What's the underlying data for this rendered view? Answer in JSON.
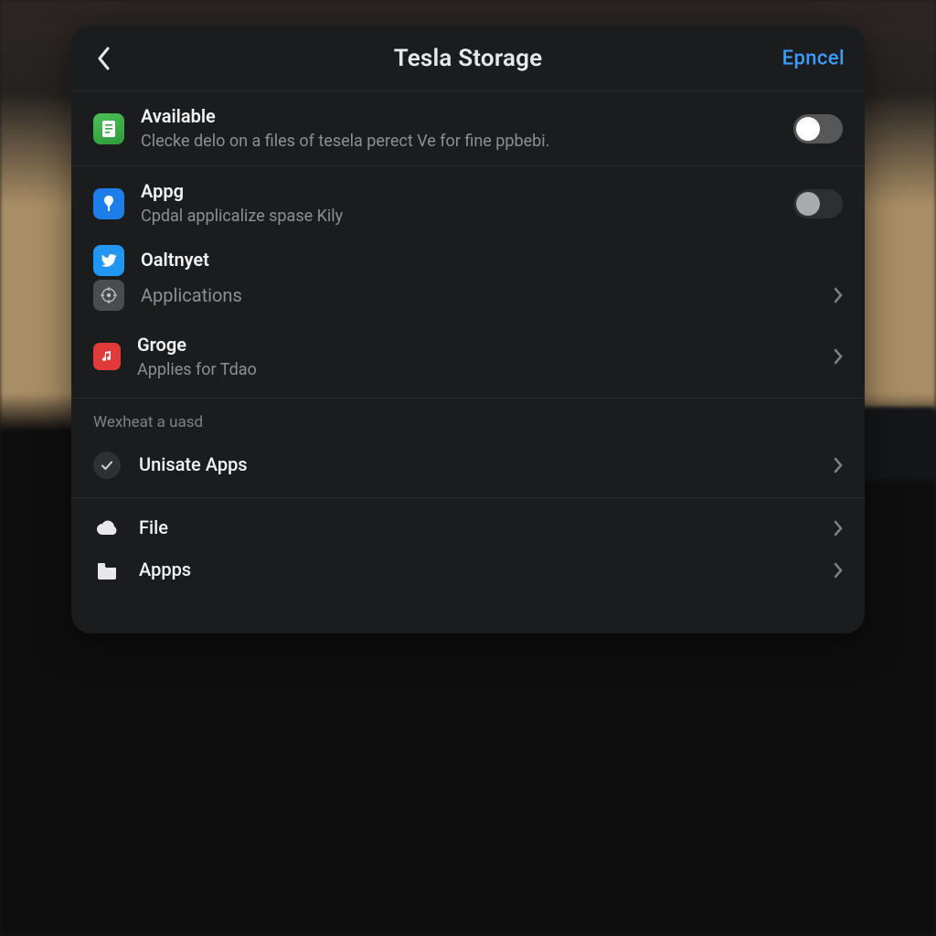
{
  "header": {
    "title": "Tesla Storage",
    "cancel": "Epncel"
  },
  "rows": {
    "available": {
      "title": "Available",
      "subtitle": "Clecke delo on a files of tesela perect Ve for fine ppbebi.",
      "toggle": true
    },
    "apps": {
      "title": "Appg",
      "subtitle": "Cpdal applicalize spase Kily",
      "toggle": false
    },
    "oaltnyet": {
      "title": "Oaltnyet",
      "applications": "Applications"
    },
    "groge": {
      "title": "Groge",
      "subtitle": "Applies for Tdao"
    }
  },
  "section": {
    "header": "Wexheat a uasd",
    "unisate": "Unisate Apps"
  },
  "bottom": {
    "file": "File",
    "apps": "Appps"
  }
}
